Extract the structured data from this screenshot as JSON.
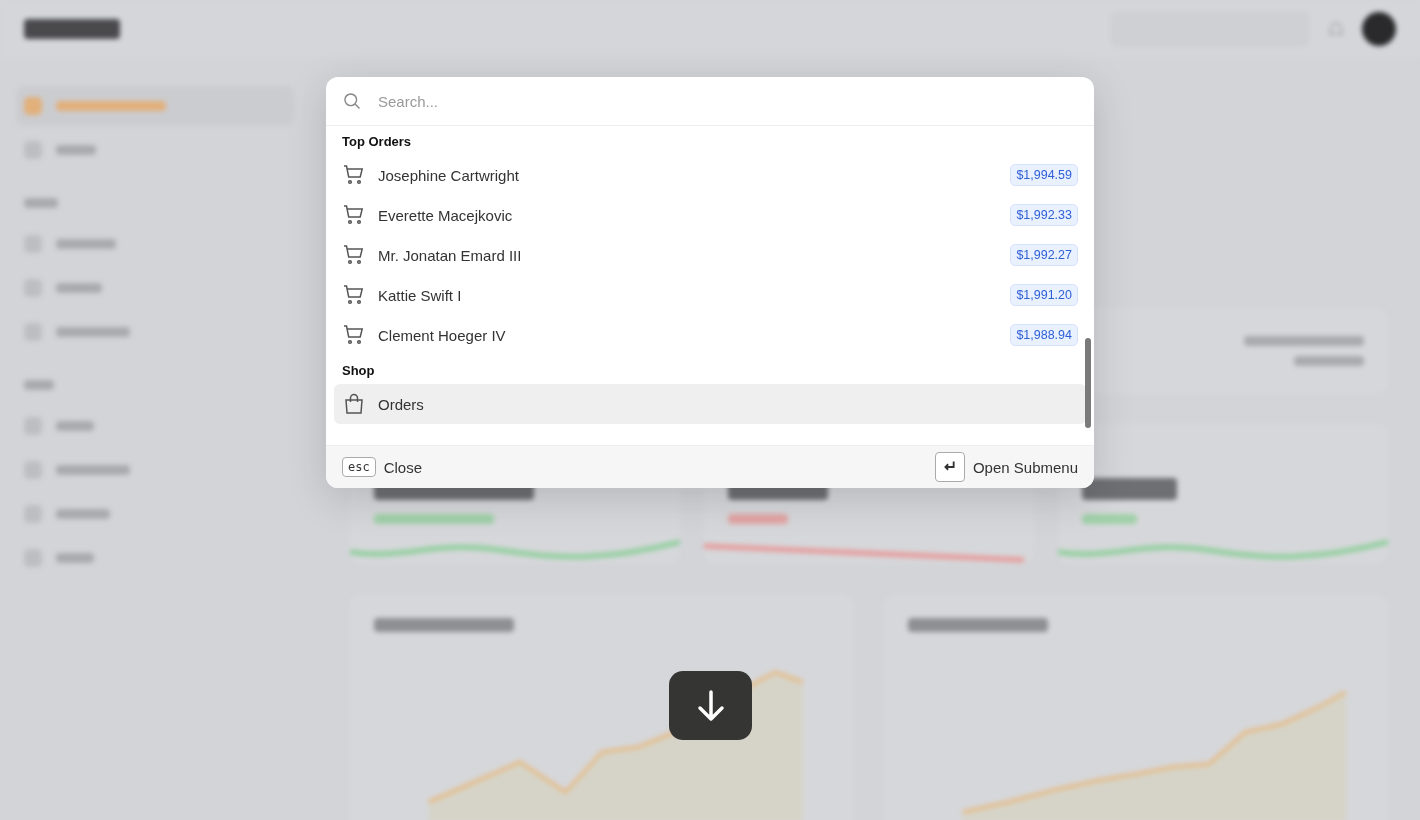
{
  "sidebar": {
    "groups": [
      {
        "items": [
          {
            "selected": true
          },
          {
            "selected": false
          }
        ]
      },
      {
        "items": [
          {
            "selected": false
          },
          {
            "selected": false
          },
          {
            "selected": false
          }
        ]
      },
      {
        "items": [
          {
            "selected": false
          },
          {
            "selected": false
          },
          {
            "selected": false
          },
          {
            "selected": false
          }
        ]
      }
    ]
  },
  "palette": {
    "search": {
      "placeholder": "Search..."
    },
    "groups": [
      {
        "label": "Top Orders",
        "items": [
          {
            "kind": "order",
            "label": "Josephine Cartwright",
            "price": "$1,994.59",
            "selected": false
          },
          {
            "kind": "order",
            "label": "Everette Macejkovic",
            "price": "$1,992.33",
            "selected": false
          },
          {
            "kind": "order",
            "label": "Mr. Jonatan Emard III",
            "price": "$1,992.27",
            "selected": false
          },
          {
            "kind": "order",
            "label": "Kattie Swift I",
            "price": "$1,991.20",
            "selected": false
          },
          {
            "kind": "order",
            "label": "Clement Hoeger IV",
            "price": "$1,988.94",
            "selected": false
          }
        ]
      },
      {
        "label": "Shop",
        "items": [
          {
            "kind": "page",
            "label": "Orders",
            "selected": true
          }
        ]
      }
    ],
    "footer": {
      "close": {
        "key": "esc",
        "label": "Close"
      },
      "submenu": {
        "label": "Open Submenu"
      }
    }
  }
}
